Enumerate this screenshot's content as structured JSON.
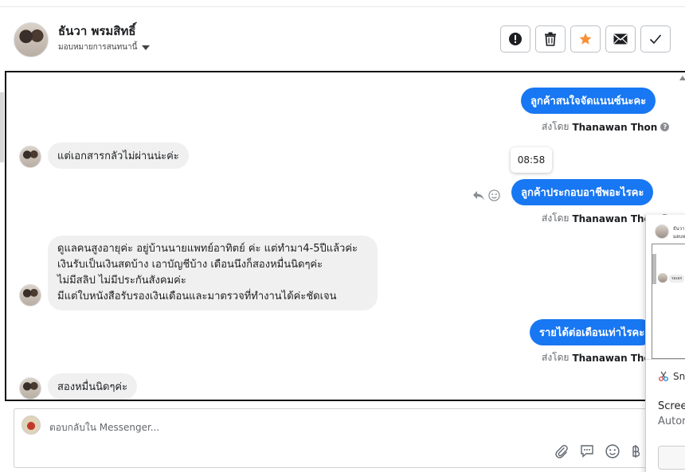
{
  "header": {
    "contact_name": "ธันวา พรมสิทธิ์",
    "assign_label": "มอบหมายการสนทนานี้"
  },
  "actions": [
    {
      "name": "report-button",
      "icon": "exclamation-icon"
    },
    {
      "name": "delete-button",
      "icon": "trash-icon"
    },
    {
      "name": "star-button",
      "icon": "star-icon",
      "color": "#f7923a"
    },
    {
      "name": "mark-unread-button",
      "icon": "envelope-icon"
    },
    {
      "name": "done-button",
      "icon": "check-icon"
    }
  ],
  "conversation": {
    "messages": [
      {
        "direction": "out",
        "text": "ลูกค้าสนใจจัดแนนซ์นะคะ",
        "sent_by_prefix": "ส่งโดย",
        "sent_by_name": "Thanawan Thon"
      },
      {
        "direction": "in",
        "text": "แต่เอกสารกลัวไม่ผ่านน่ะค่ะ"
      },
      {
        "direction": "out",
        "text": "ลูกค้าประกอบอาชีพอะไรคะ",
        "sent_by_prefix": "ส่งโดย",
        "sent_by_name": "Thanawan Thon"
      },
      {
        "direction": "in",
        "lines": [
          "ดูแลคนสูงอายุค่ะ อยู่บ้านนายแพทย์อาทิตย์ ค่ะ แต่ทำมา4-5ปีแล้วค่ะ",
          "เงินรับเป็นเงินสดบ้าง เอาบัญชีบ้าง เดือนนึงก็สองหมื่นนิดๆค่ะ",
          "ไม่มีสลิป ไม่มีประกันสังคมค่ะ",
          "มีแต่ใบหนังสือรับรองเงินเดือนและมาตรวจที่ทำงานได้ค่ะชัดเจน"
        ]
      },
      {
        "direction": "out",
        "text": "รายได้ต่อเดือนเท่าไรคะ",
        "sent_by_prefix": "ส่งโดย",
        "sent_by_name": "Thanawan Thon"
      },
      {
        "direction": "in",
        "text": "สองหมื่นนิดๆค่ะ"
      }
    ],
    "timestamp_tooltip": "08:58"
  },
  "composer": {
    "placeholder": "ตอบกลับใน Messenger..."
  },
  "floating_panel": {
    "name_snippet": "ธันวา",
    "assign_snippet": "มอบห",
    "msg_snippet": "รอเอก",
    "sn_label": "Sn",
    "screen_label": "Screer",
    "auto_label": "Auton"
  },
  "colors": {
    "outgoing_bubble": "#1877f2",
    "incoming_bubble": "#f0f0f0"
  }
}
